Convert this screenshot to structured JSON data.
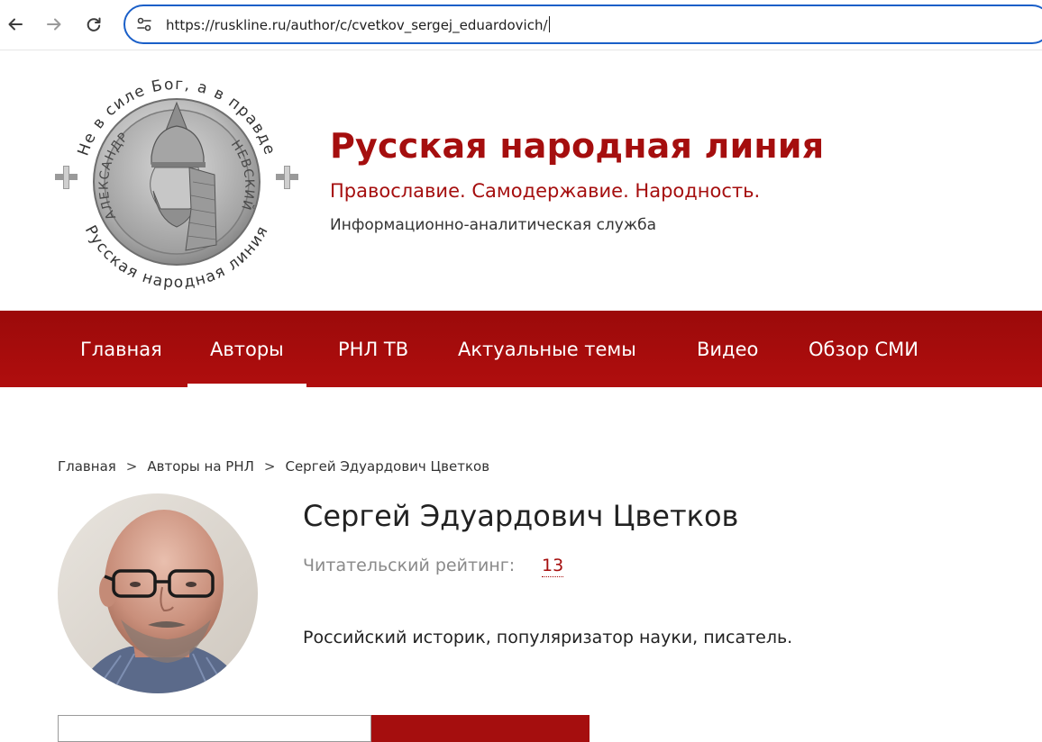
{
  "browser": {
    "url": "https://ruskline.ru/author/c/cvetkov_sergej_eduardovich/"
  },
  "site": {
    "title": "Русская народная линия",
    "motto": "Православие. Самодержавие. Народность.",
    "subtitle": "Информационно-аналитическая служба",
    "accent_color": "#a50e0e",
    "logo": {
      "ring_text_top": "Не в силе Бог, а в правде",
      "ring_text_bottom": "Русская народная линия",
      "inner_text_left": "АЛЕКСАНДР",
      "inner_text_right": "НЕВСКИЙ"
    }
  },
  "nav": {
    "items": [
      {
        "label": "Главная"
      },
      {
        "label": "Авторы",
        "active": true
      },
      {
        "label": "РНЛ ТВ"
      },
      {
        "label": "Актуальные темы"
      },
      {
        "label": "Видео"
      },
      {
        "label": "Обзор СМИ"
      }
    ]
  },
  "breadcrumb": {
    "items": [
      "Главная",
      "Авторы на РНЛ",
      "Сергей Эдуардович Цветков"
    ],
    "separator": ">"
  },
  "author": {
    "name": "Сергей Эдуардович Цветков",
    "rating_label": "Читательский рейтинг:",
    "rating_value": "13",
    "description": "Российский историк, популяризатор науки, писатель."
  }
}
